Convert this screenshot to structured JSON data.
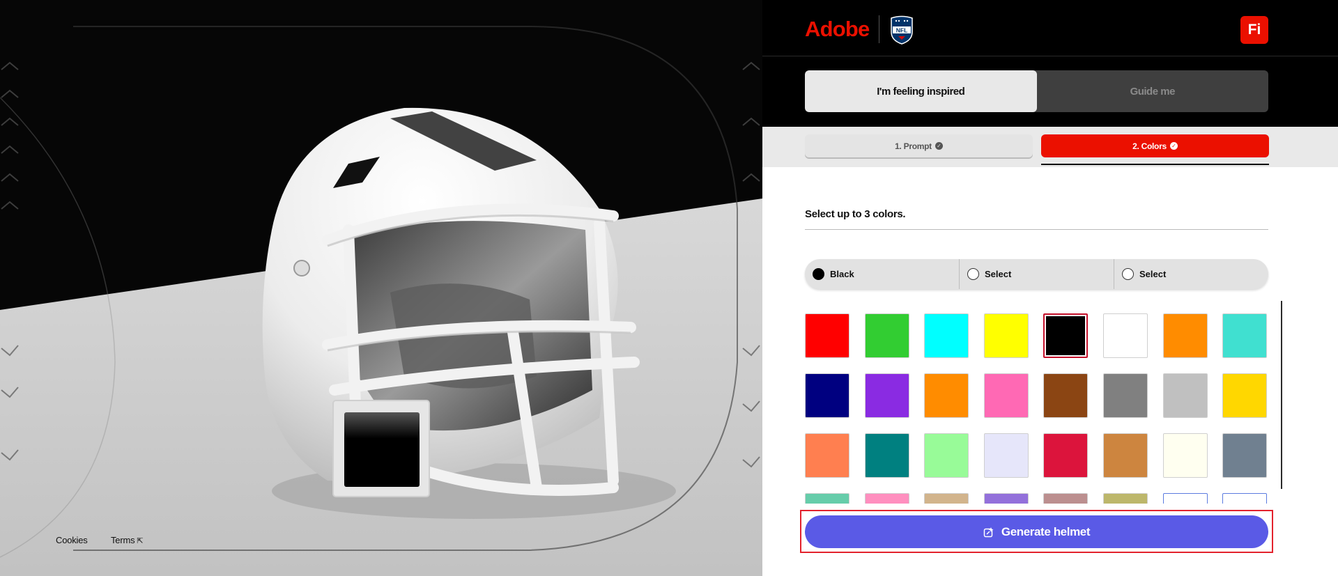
{
  "stage": {
    "footer": {
      "cookies": "Cookies",
      "terms": "Terms",
      "terms_icon": "external-link-icon"
    },
    "team_color_chip": "#000000"
  },
  "header": {
    "brand": "Adobe",
    "partner_logo": "NFL",
    "user_badge": "Fi"
  },
  "mode_toggle": {
    "inspired": "I'm feeling inspired",
    "guide": "Guide me",
    "active": "inspired"
  },
  "steps": {
    "prompt": "1. Prompt",
    "colors": "2. Colors",
    "active": "colors",
    "check_icon": "check-circle-icon"
  },
  "colors": {
    "instruction": "Select up to 3 colors.",
    "slots": [
      {
        "label": "Black",
        "color": "#000000",
        "filled": true
      },
      {
        "label": "Select",
        "color": null,
        "filled": false
      },
      {
        "label": "Select",
        "color": null,
        "filled": false
      }
    ],
    "swatches": [
      {
        "name": "Red",
        "hex": "#FF0000"
      },
      {
        "name": "Green",
        "hex": "#32CD32"
      },
      {
        "name": "Cyan",
        "hex": "#00FFFF"
      },
      {
        "name": "Yellow",
        "hex": "#FFFF00"
      },
      {
        "name": "Black",
        "hex": "#000000",
        "selected": true
      },
      {
        "name": "White",
        "hex": "#FFFFFF"
      },
      {
        "name": "Orange",
        "hex": "#FF8C00"
      },
      {
        "name": "Turquoise",
        "hex": "#40E0D0"
      },
      {
        "name": "Navy",
        "hex": "#000080"
      },
      {
        "name": "Purple",
        "hex": "#8A2BE2"
      },
      {
        "name": "Dark Orange",
        "hex": "#FF8C00"
      },
      {
        "name": "Pink",
        "hex": "#FF69B4"
      },
      {
        "name": "Brown",
        "hex": "#8B4513"
      },
      {
        "name": "Gray",
        "hex": "#808080"
      },
      {
        "name": "Silver",
        "hex": "#C0C0C0"
      },
      {
        "name": "Gold",
        "hex": "#FFD700"
      },
      {
        "name": "Coral",
        "hex": "#FF7F50"
      },
      {
        "name": "Teal",
        "hex": "#008080"
      },
      {
        "name": "Pale Green",
        "hex": "#98FB98"
      },
      {
        "name": "Lavender",
        "hex": "#E6E6FA"
      },
      {
        "name": "Crimson",
        "hex": "#DC143C"
      },
      {
        "name": "Peru",
        "hex": "#CD853F"
      },
      {
        "name": "Ivory",
        "hex": "#FFFFF0"
      },
      {
        "name": "Slate Gray",
        "hex": "#708090"
      },
      {
        "name": "Aquamarine",
        "hex": "#66CDAA"
      },
      {
        "name": "Hot Pink",
        "hex": "#FF8FBF"
      },
      {
        "name": "Tan",
        "hex": "#D2B48C"
      },
      {
        "name": "Medium Purple",
        "hex": "#9370DB"
      },
      {
        "name": "Rosy Brown",
        "hex": "#BC8F8F"
      },
      {
        "name": "Khaki",
        "hex": "#BDB76B"
      },
      {
        "name": "White Outline",
        "hex": "#FFFFFF",
        "outline": true
      },
      {
        "name": "White Outline 2",
        "hex": "#FFFFFF",
        "outline": true
      }
    ]
  },
  "actions": {
    "generate": "Generate helmet",
    "generate_icon": "sparkle-edit-icon"
  },
  "accent": {
    "adobe_red": "#EB1000",
    "generate_blue": "#5A5AE6"
  }
}
